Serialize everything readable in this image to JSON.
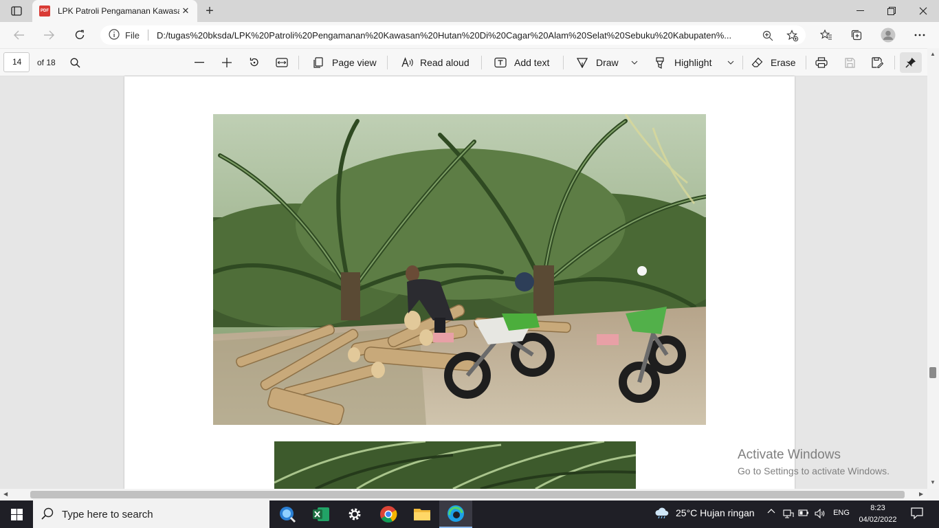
{
  "browser": {
    "tab_title": "LPK Patroli Pengamanan Kawasan Hutan",
    "tab_icon_label": "PDF",
    "address_scheme": "File",
    "url": "D:/tugas%20bksda/LPK%20Patroli%20Pengamanan%20Kawasan%20Hutan%20Di%20Cagar%20Alam%20Selat%20Sebuku%20Kabupaten%..."
  },
  "pdf_toolbar": {
    "page_number": "14",
    "page_total": "of 18",
    "page_view": "Page view",
    "read_aloud": "Read aloud",
    "add_text": "Add text",
    "draw": "Draw",
    "highlight": "Highlight",
    "erase": "Erase"
  },
  "watermark": {
    "title": "Activate Windows",
    "subtitle": "Go to Settings to activate Windows."
  },
  "taskbar": {
    "search_placeholder": "Type here to search",
    "weather": "25°C  Hujan ringan",
    "language": "ENG",
    "time": "8:23",
    "date": "04/02/2022"
  },
  "colors": {
    "pdf_icon": "#d93b35",
    "taskbar_bg": "#1f1f26",
    "excel": "#1d6f42",
    "edge": "#1da1e8"
  }
}
